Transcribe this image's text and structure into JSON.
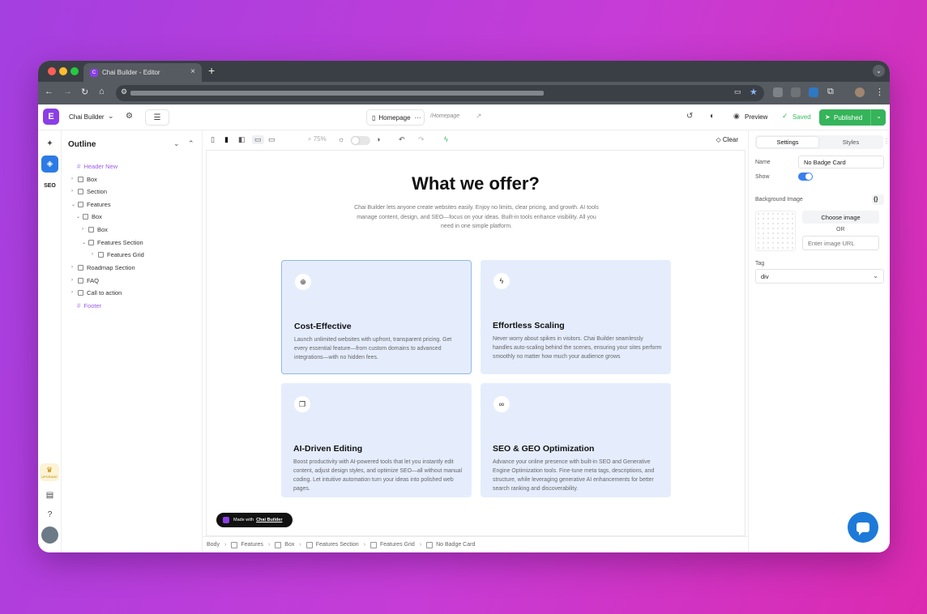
{
  "browser": {
    "tab_title": "Chai Builder - Editor",
    "new_tab": "+",
    "tab_close": "×"
  },
  "app": {
    "project_name": "Chai Builder",
    "page_name": "Homepage",
    "page_slug": "/Homepage",
    "preview_label": "Preview",
    "saved_label": "Saved",
    "publish_label": "Published",
    "brand_color": "#8b3ee6",
    "publish_color": "#35b45a",
    "accent_color": "#3a7ef0"
  },
  "rail": {
    "seo_label": "SEO",
    "upgrade_label": "UPGRADE"
  },
  "outline": {
    "title": "Outline",
    "items": [
      {
        "label": "Header New",
        "kind": "hash"
      },
      {
        "label": "Box",
        "kind": "box"
      },
      {
        "label": "Section",
        "kind": "box"
      },
      {
        "label": "Features",
        "kind": "box"
      },
      {
        "label": "Box",
        "kind": "box"
      },
      {
        "label": "Box",
        "kind": "box"
      },
      {
        "label": "Features Section",
        "kind": "box"
      },
      {
        "label": "Features Grid",
        "kind": "box"
      },
      {
        "label": "Roadmap Section",
        "kind": "box"
      },
      {
        "label": "FAQ",
        "kind": "box"
      },
      {
        "label": "Call to action",
        "kind": "box"
      },
      {
        "label": "Footer",
        "kind": "hash"
      }
    ]
  },
  "canvas_toolbar": {
    "zoom": "75%",
    "clear_label": "Clear"
  },
  "page": {
    "heading": "What we offer?",
    "lead": "Chai Builder lets anyone create websites easily. Enjoy no limits, clear pricing, and growth. AI tools manage content, design, and SEO—focus on your ideas. Built-in tools enhance visibility. All you need in one simple platform.",
    "cards": [
      {
        "title": "Cost-Effective",
        "desc": "Launch unlimited websites with upfront, transparent pricing. Get every essential feature—from custom domains to advanced integrations—with no hidden fees.",
        "icon": "search-plus-icon"
      },
      {
        "title": "Effortless Scaling",
        "desc": "Never worry about spikes in visitors. Chai Builder seamlessly handles auto-scaling behind the scenes, ensuring your sites perform smoothly no matter how much your audience grows",
        "icon": "bolt-icon"
      },
      {
        "title": "AI-Driven Editing",
        "desc": "Boost productivity with AI-powered tools that let you instantly edit content, adjust design styles, and optimize SEO—all without manual coding. Let intuitive automation turn your ideas into polished web pages.",
        "icon": "chat-icon"
      },
      {
        "title": "SEO & GEO Optimization",
        "desc": "Advance your online presence with built-in SEO and Generative Engine Optimization tools. Fine-tune meta tags, descriptions, and structure, while leveraging generative AI enhancements for better search ranking and discoverability.",
        "icon": "infinity-icon"
      }
    ],
    "made_with": "Made with",
    "made_with_brand": "Chai Builder"
  },
  "breadcrumb": [
    "Body",
    "Features",
    "Box",
    "Features Section",
    "Features Grid",
    "No Badge Card"
  ],
  "settings": {
    "tab_settings": "Settings",
    "tab_styles": "Styles",
    "name_label": "Name",
    "name_value": "No Badge Card",
    "show_label": "Show",
    "bg_label": "Background Image",
    "code_icon": "{}",
    "choose_image": "Choose image",
    "or_label": "OR",
    "url_placeholder": "Enter image URL",
    "tag_label": "Tag",
    "tag_value": "div"
  }
}
